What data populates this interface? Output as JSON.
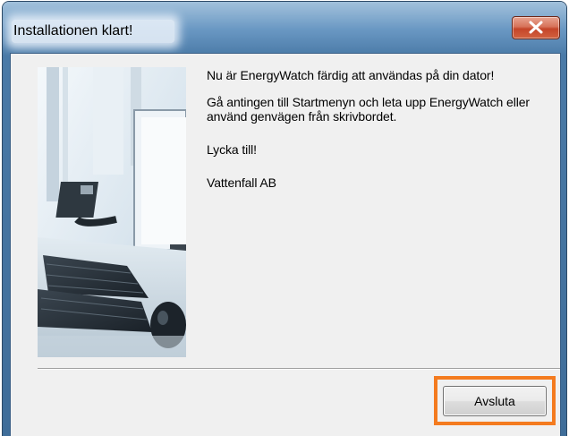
{
  "window": {
    "title": "Installationen klart!",
    "close_icon": "close-icon"
  },
  "content": {
    "paragraphs": [
      "Nu är EnergyWatch färdig att användas på din dator!",
      "Gå antingen till Startmenyn och leta upp EnergyWatch eller använd genvägen från skrivbordet.",
      "Lycka till!",
      "Vattenfall AB"
    ],
    "illustration": "office-desk-image"
  },
  "footer": {
    "finish_label": "Avsluta"
  },
  "colors": {
    "highlight": "#f47b1f",
    "titlebar": "#5a8dbd",
    "dialog_bg": "#f0f0f0"
  }
}
